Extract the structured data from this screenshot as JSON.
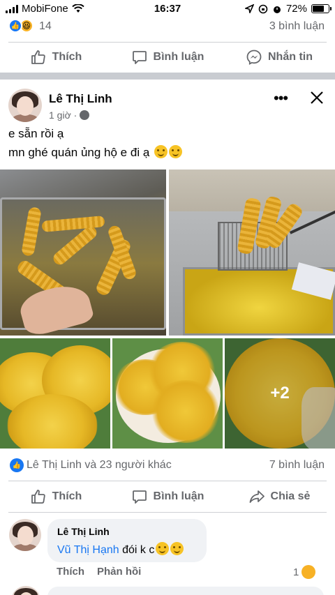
{
  "status_bar": {
    "carrier": "MobiFone",
    "time": "16:37",
    "battery": "72%",
    "battery_level": 0.72
  },
  "prev_post": {
    "reaction_count": "14",
    "comment_count": "3 bình luận",
    "actions": {
      "like": "Thích",
      "comment": "Bình luận",
      "message": "Nhắn tin"
    }
  },
  "post": {
    "author": "Lê Thị Linh",
    "time": "1 giờ ·",
    "text_line1": "e sẵn rồi ạ",
    "text_line2": "mn ghé quán ủng hộ e đi ạ",
    "more_photos": "+2",
    "likes": "Lê Thị Linh và 23 người khác",
    "comments": "7 bình luận",
    "actions": {
      "like": "Thích",
      "comment": "Bình luận",
      "share": "Chia sẻ"
    }
  },
  "comment": {
    "author": "Lê Thị Linh",
    "mention": "Vũ Thị Hạnh",
    "text": " đói k c",
    "like": "Thích",
    "reply": "Phản hồi",
    "reaction_count": "1"
  },
  "icons": [
    "wifi-icon",
    "location-icon",
    "alarm-icon",
    "like-icon",
    "comment-icon",
    "messenger-icon",
    "share-icon",
    "globe-icon",
    "close-icon",
    "more-icon"
  ],
  "colors": {
    "accent": "#1877f2",
    "muted": "#65676b",
    "separator": "#c9ccd1"
  }
}
